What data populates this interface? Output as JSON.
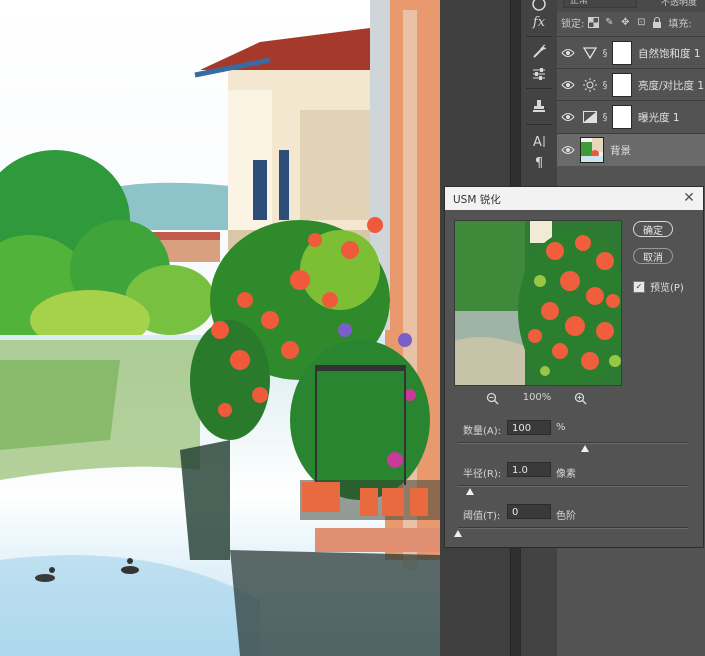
{
  "layers_panel": {
    "blend_mode": "正常",
    "opacity_label": "不透明度",
    "lock_label": "锁定:",
    "fill_label": "填充:",
    "layers": [
      {
        "name": "自然饱和度 1",
        "type": "vibrance",
        "icon": "vibrance-icon",
        "visible": true,
        "selected": false
      },
      {
        "name": "亮度/对比度 1",
        "type": "brightness-contrast",
        "icon": "sun-icon",
        "visible": true,
        "selected": false
      },
      {
        "name": "曝光度 1",
        "type": "exposure",
        "icon": "exposure-icon",
        "visible": true,
        "selected": false
      },
      {
        "name": "背景",
        "type": "pixel",
        "icon": "image-thumbnail",
        "visible": true,
        "selected": true
      }
    ]
  },
  "toolbar": {
    "tools": [
      "fx-icon",
      "brush-icon",
      "adjust-sliders-icon",
      "stamp-icon",
      "character-icon",
      "paragraph-icon"
    ]
  },
  "dialog": {
    "title": "USM 锐化",
    "ok_label": "确定",
    "cancel_label": "取消",
    "preview_label": "预览(P)",
    "preview_checked": true,
    "zoom": "100%",
    "amount": {
      "label": "数量(A):",
      "value": "100",
      "unit": "%",
      "slider_fraction": 0.55
    },
    "radius": {
      "label": "半径(R):",
      "value": "1.0",
      "unit": "像素",
      "slider_fraction": 0.05
    },
    "threshold": {
      "label": "阈值(T):",
      "value": "0",
      "unit": "色阶",
      "slider_fraction": 0.0
    }
  },
  "colors": {
    "panel_bg": "#535353",
    "selected_layer": "#6a6a6a",
    "dialog_titlebar": "#f2f2f2"
  }
}
